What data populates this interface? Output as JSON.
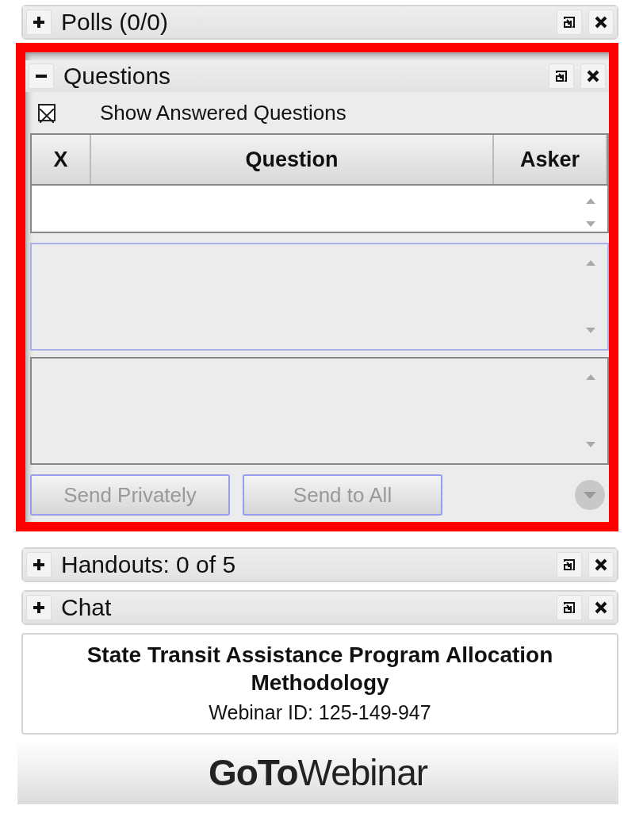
{
  "panels": [
    {
      "title": "Polls (0/0)",
      "expanded": false,
      "highlighted": false
    },
    {
      "title": "Questions",
      "expanded": true,
      "highlighted": true,
      "show_answered": {
        "label": "Show Answered Questions",
        "checked": true
      },
      "table": {
        "columns": [
          "X",
          "Question",
          "Asker"
        ]
      },
      "buttons": [
        {
          "label": "Send Privately",
          "disabled": true
        },
        {
          "label": "Send to All",
          "disabled": true
        }
      ]
    },
    {
      "title": "Handouts: 0 of 5",
      "expanded": false,
      "highlighted": false
    },
    {
      "title": "Chat",
      "expanded": false,
      "highlighted": false
    }
  ],
  "session": {
    "title": "State Transit Assistance Program Allocation Methodology",
    "webinar_id": "Webinar ID: 125-149-947"
  },
  "brand": {
    "logo": "**GoTo**Webinar"
  }
}
